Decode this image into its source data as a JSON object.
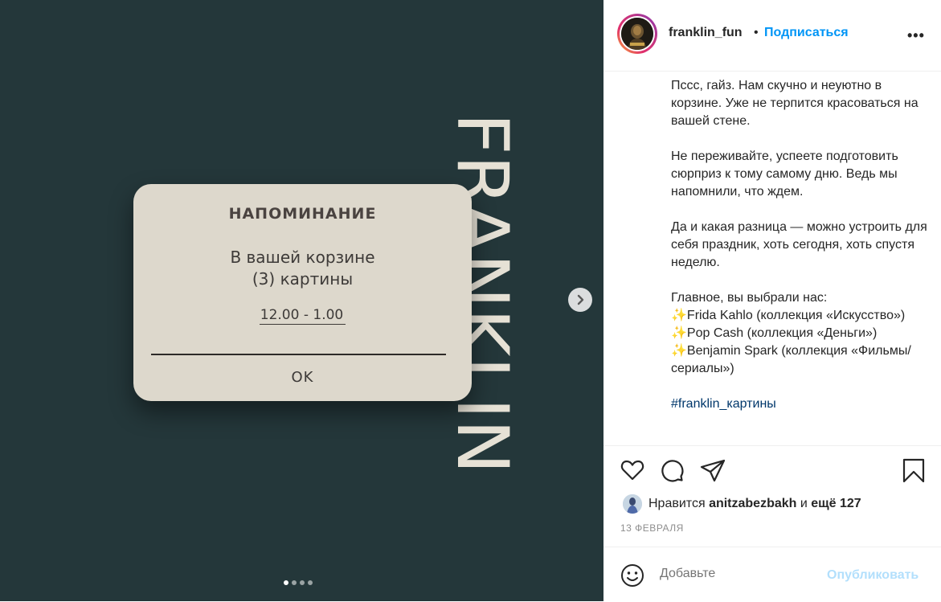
{
  "post_image": {
    "brand_vertical": "FRANKLIN",
    "dialog": {
      "title": "НАПОМИНАНИЕ",
      "message_line1": "В вашей корзине",
      "message_line2": "(3) картины",
      "time": "12.00 - 1.00",
      "ok_label": "OK"
    },
    "carousel": {
      "total_slides": 4,
      "active_slide": 1
    }
  },
  "header": {
    "username": "franklin_fun",
    "separator": "•",
    "follow_label": "Подписаться",
    "more_label": "•••"
  },
  "caption": {
    "p1": "Пссс, гайз. Нам скучно и неуютно в корзине. Уже не терпится красоваться на вашей стене.",
    "p2": "Не переживайте, успеете подготовить сюрприз к тому самому дню. Ведь мы напомнили, что ждем.",
    "p3": "Да и какая разница — можно устроить для себя праздник, хоть сегодня, хоть спустя неделю.",
    "p4_line1": "Главное, вы выбрали нас:",
    "p4_line2": "✨Frida Kahlo (коллекция «Искусство»)",
    "p4_line3": "✨Pop Cash (коллекция «Деньги»)",
    "p4_line4": "✨Benjamin Spark (коллекция «Фильмы/сериалы»)",
    "hashtag": "#franklin_картины"
  },
  "likes": {
    "prefix": "Нравится",
    "user": "anitzabezbakh",
    "conjunction": "и",
    "more": "ещё 127"
  },
  "date": "13 ФЕВРАЛЯ",
  "comment": {
    "placeholder": "Добавьте",
    "publish_label": "Опубликовать"
  },
  "colors": {
    "image_bg": "#24373a",
    "dialog_bg": "#ddd8cc",
    "brand_text": "#e6e1d5",
    "follow_blue": "#0095f6",
    "publish_disabled": "#b2dffc",
    "hashtag": "#00376b"
  },
  "icons": [
    "chevron-right-icon",
    "heart-icon",
    "comment-icon",
    "share-icon",
    "bookmark-icon",
    "emoji-icon"
  ]
}
